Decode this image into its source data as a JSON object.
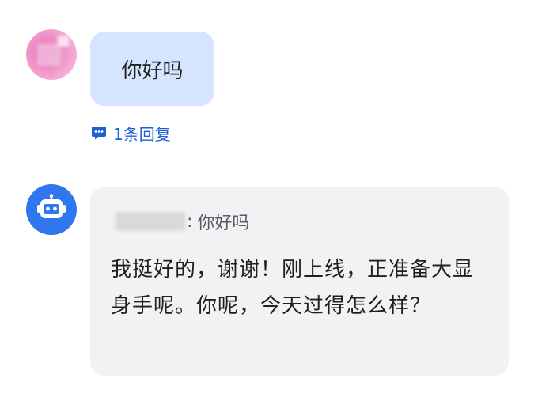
{
  "thread": {
    "user_message": {
      "text": "你好吗",
      "reply_count_label": "1条回复"
    },
    "bot_message": {
      "quote_separator": ":",
      "quoted_text": "你好吗",
      "text": "我挺好的，谢谢！刚上线，正准备大显身手呢。你呢，今天过得怎么样？"
    }
  },
  "colors": {
    "user_bubble": "#d6e5ff",
    "bot_bubble": "#f2f2f4",
    "link_blue": "#1e5fd6",
    "bot_avatar": "#2f76ef",
    "user_avatar": "#e86bb3"
  },
  "icons": {
    "reply": "comment-bubble-icon",
    "bot_avatar": "robot-icon"
  }
}
